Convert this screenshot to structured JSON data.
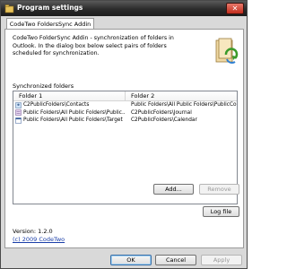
{
  "window": {
    "title": "Program settings"
  },
  "tab": {
    "label": "CodeTwo FoldersSync Addin"
  },
  "description": "CodeTwo FolderSync Addin - synchronization of folders in Outlook. In the dialog box below select pairs of folders scheduled for synchronization.",
  "synchronized": {
    "label": "Synchronized folders",
    "columns": [
      "Folder 1",
      "Folder 2"
    ],
    "rows": [
      {
        "folder1": "C2PublicFolders\\Contacts",
        "folder2": "Public Folders\\All Public Folders\\PublicCo..."
      },
      {
        "folder1": "Public Folders\\All Public Folders\\Public...",
        "folder2": "C2PublicFolders\\Journal"
      },
      {
        "folder1": "Public Folders\\All Public Folders\\Target",
        "folder2": "C2PublicFolders\\Calendar"
      }
    ]
  },
  "buttons": {
    "add": "Add...",
    "remove": "Remove",
    "log": "Log file",
    "ok": "OK",
    "cancel": "Cancel",
    "apply": "Apply"
  },
  "version": "Version: 1.2.0",
  "copyright": "(c) 2009 CodeTwo"
}
